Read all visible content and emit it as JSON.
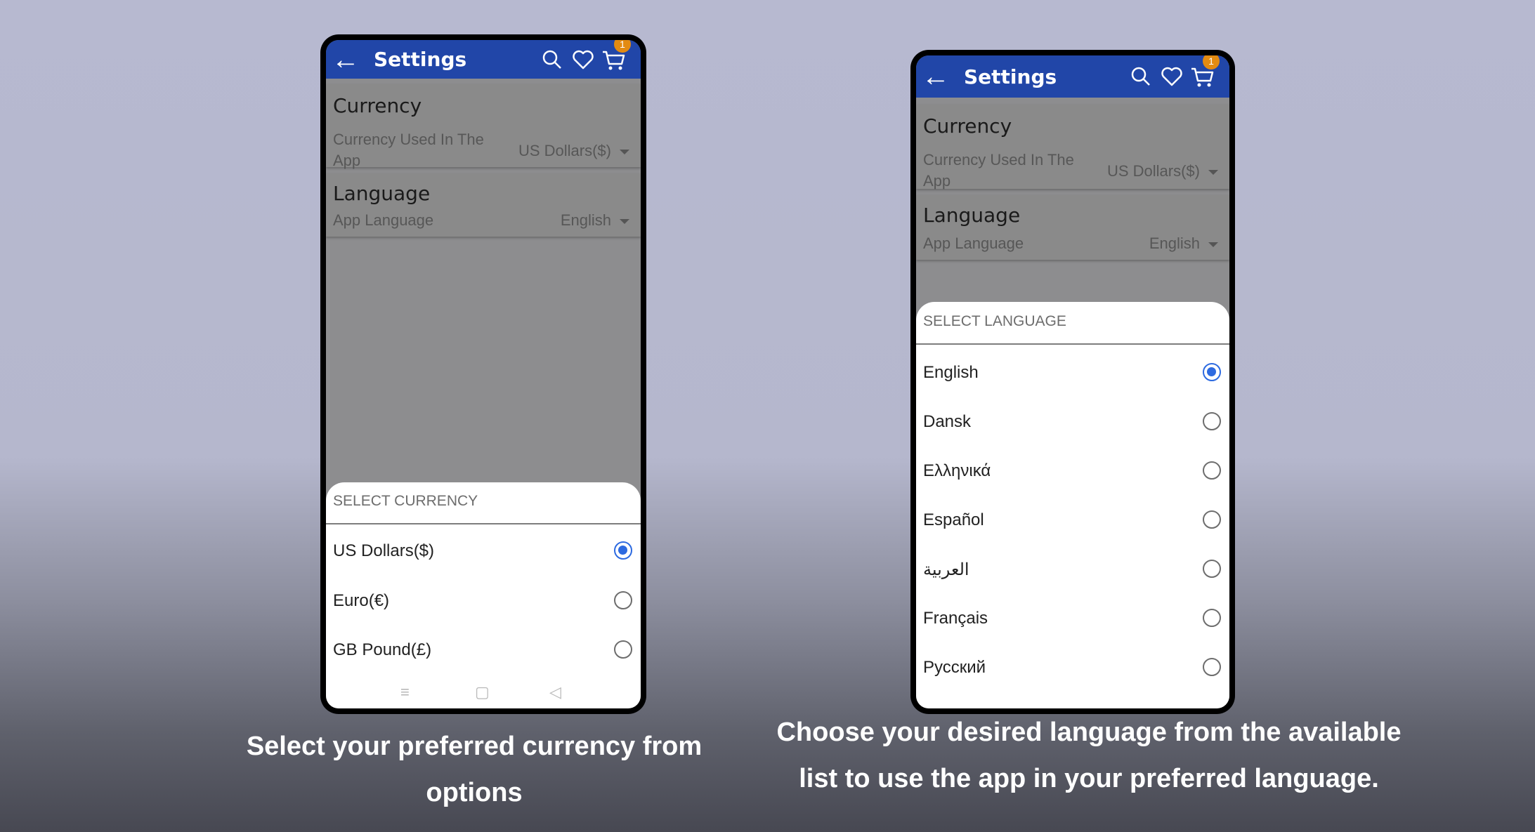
{
  "left_screen": {
    "appbar": {
      "back_icon": "arrow-left-icon",
      "title": "Settings",
      "cart_badge": "1"
    },
    "currency_card": {
      "heading": "Currency",
      "subtitle": "Currency Used In The App",
      "value": "US Dollars($)"
    },
    "language_card": {
      "heading": "Language",
      "subtitle": "App Language",
      "value": "English"
    },
    "sheet": {
      "title": "SELECT CURRENCY",
      "options": [
        {
          "label": "US Dollars($)",
          "selected": true
        },
        {
          "label": "Euro(€)",
          "selected": false
        },
        {
          "label": "GB Pound(£)",
          "selected": false
        }
      ]
    },
    "navbar": {
      "menu": "≡",
      "home": "▢",
      "back": "◁"
    }
  },
  "right_screen": {
    "appbar": {
      "back_icon": "arrow-left-icon",
      "title": "Settings",
      "cart_badge": "1"
    },
    "currency_card": {
      "heading": "Currency",
      "subtitle": "Currency Used In The App",
      "value": "US Dollars($)"
    },
    "language_card": {
      "heading": "Language",
      "subtitle": "App Language",
      "value": "English"
    },
    "sheet": {
      "title": "SELECT LANGUAGE",
      "options": [
        {
          "label": "English",
          "selected": true
        },
        {
          "label": "Dansk",
          "selected": false
        },
        {
          "label": "Ελληνικά",
          "selected": false
        },
        {
          "label": "Español",
          "selected": false
        },
        {
          "label": "العربية",
          "selected": false
        },
        {
          "label": "Français",
          "selected": false
        },
        {
          "label": "Русский",
          "selected": false
        }
      ]
    }
  },
  "captions": {
    "left": "Select your preferred currency from options",
    "right": "Choose your desired language from the available list to use the app in your preferred language."
  },
  "colors": {
    "appbar": "#2146a8",
    "accent": "#2d6ae0",
    "badge": "#e38b12"
  }
}
